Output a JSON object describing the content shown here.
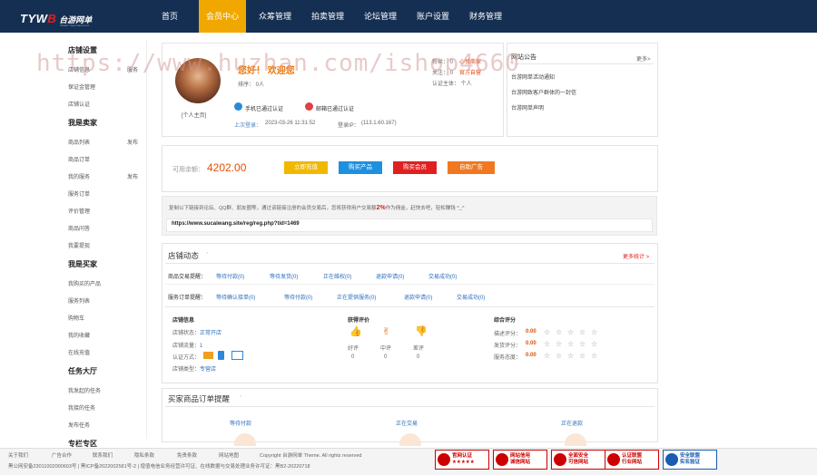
{
  "logo": {
    "brand_a": "TYW",
    "brand_b": "B",
    "name": "台游网单",
    "tagline": "Taiwan Youju Game Ltd."
  },
  "nav": [
    "首页",
    "会员中心",
    "众筹管理",
    "拍卖管理",
    "论坛管理",
    "账户设置",
    "财务管理"
  ],
  "sidebar": {
    "shop": {
      "title": "店铺设置",
      "items": [
        "店铺信息",
        "保证金管理",
        "店铺认证"
      ],
      "tags": [
        "服务"
      ]
    },
    "seller": {
      "title": "我是卖家",
      "items": [
        "商品列表",
        "商品订单",
        "我的服务",
        "服务订单",
        "评价管理",
        "商品问答",
        "我要提现"
      ],
      "tags": [
        "发布",
        "发布"
      ]
    },
    "buyer": {
      "title": "我是买家",
      "items": [
        "我购买的产品",
        "服务列表",
        "购物车",
        "我的收藏",
        "在线充值"
      ]
    },
    "task": {
      "title": "任务大厅",
      "items": [
        "我发起的任务",
        "我接的任务",
        "发布任务"
      ]
    },
    "more": {
      "title": "专栏专区"
    }
  },
  "profile": {
    "welcome": "您好！ 欢迎您",
    "rank": "排序： 0人",
    "avatar_caption": "[个人主页]",
    "phone_verified": "手机已通过认证",
    "email_verified": "邮箱已通过认证",
    "last_login_label": "上次登录：",
    "last_login": "2023-03-26 11:31:52",
    "ip_label": "登录IP：",
    "ip": "(113.1.60.167)",
    "stats": [
      "粉丝： 0",
      "关注： 0",
      "认证主体： 个人"
    ],
    "tags": [
      "心悦商家",
      "官方自营"
    ]
  },
  "notice": {
    "title": "网站公告",
    "more": "更多>",
    "items": [
      "台游网单活动通知",
      "台游网致客户群体的一封信",
      "台游网单声明"
    ]
  },
  "balance": {
    "label": "可用余额：",
    "value": "4202.00",
    "buttons": [
      "立即充值",
      "购买产品",
      "购买会员",
      "自助广告"
    ]
  },
  "invite": {
    "text": "复制以下链接到论坛、QQ群、朋友圈等，通过该链接注册的会员交易后，您将获得用户交易额",
    "pct": "2%",
    "text2": "作为佣金，赶快去吧，轻松赚钱 ^_^",
    "url": "https://www.sucaiwang.site/reg/reg.php?tid=1469"
  },
  "dynamics": {
    "title": "店铺动态",
    "more": "更多统计 >",
    "row1": {
      "label": "商品交易提醒：",
      "items": [
        [
          "等待付款",
          "(0)"
        ],
        [
          "等待发货",
          "(0)"
        ],
        [
          "正在维权",
          "(0)"
        ],
        [
          "退款申请",
          "(0)"
        ],
        [
          "交易成功",
          "(0)"
        ]
      ]
    },
    "row2": {
      "label": "服务订单提醒：",
      "items": [
        [
          "等待确认接单",
          "(0)"
        ],
        [
          "等待付款",
          "(0)"
        ],
        [
          "正在提供服务",
          "(0)"
        ],
        [
          "退款申请",
          "(0)"
        ],
        [
          "交易成功",
          "(0)"
        ]
      ]
    }
  },
  "shop_info": {
    "title": "店铺信息",
    "status_label": "店铺状态：",
    "status": "正常开店",
    "views_label": "店铺流量：",
    "views": "1",
    "auth_label": "认证方式：",
    "type_label": "店铺类型：",
    "type": "专营店"
  },
  "rating": {
    "title": "获得评价",
    "items": [
      [
        "好评",
        "0"
      ],
      [
        "中评",
        "0"
      ],
      [
        "差评",
        "0"
      ]
    ]
  },
  "score": {
    "title": "综合评分",
    "items": [
      [
        "描述评分：",
        "0.00"
      ],
      [
        "发货评分：",
        "0.00"
      ],
      [
        "服务态度：",
        "0.00"
      ]
    ]
  },
  "orders": {
    "title": "买家商品订单提醒",
    "tabs": [
      "等待付款",
      "正在交易",
      "正在退款"
    ]
  },
  "footer": {
    "links": [
      "关于我们",
      "广告合作",
      "联系我们",
      "隐私条款",
      "免责条款",
      "网站地图",
      "Copyright   台游网单  Theme. All rights reserved"
    ],
    "icp": "黑公网安备23011002000603号 | 黑ICP备2022002581号-2 | 增值电信业务经营许可证、在线数据与交易处理业务许可证：黑B2-20220718",
    "badges": [
      [
        "官网认证",
        "★★★★★"
      ],
      [
        "网站信用",
        "诚信网站"
      ],
      [
        "全面安全",
        "可信网站"
      ],
      [
        "认证联盟",
        "行业网站"
      ],
      [
        "安全联盟",
        "实名验证"
      ]
    ]
  },
  "watermark": "https://www.huzhan.com/ishop4660"
}
